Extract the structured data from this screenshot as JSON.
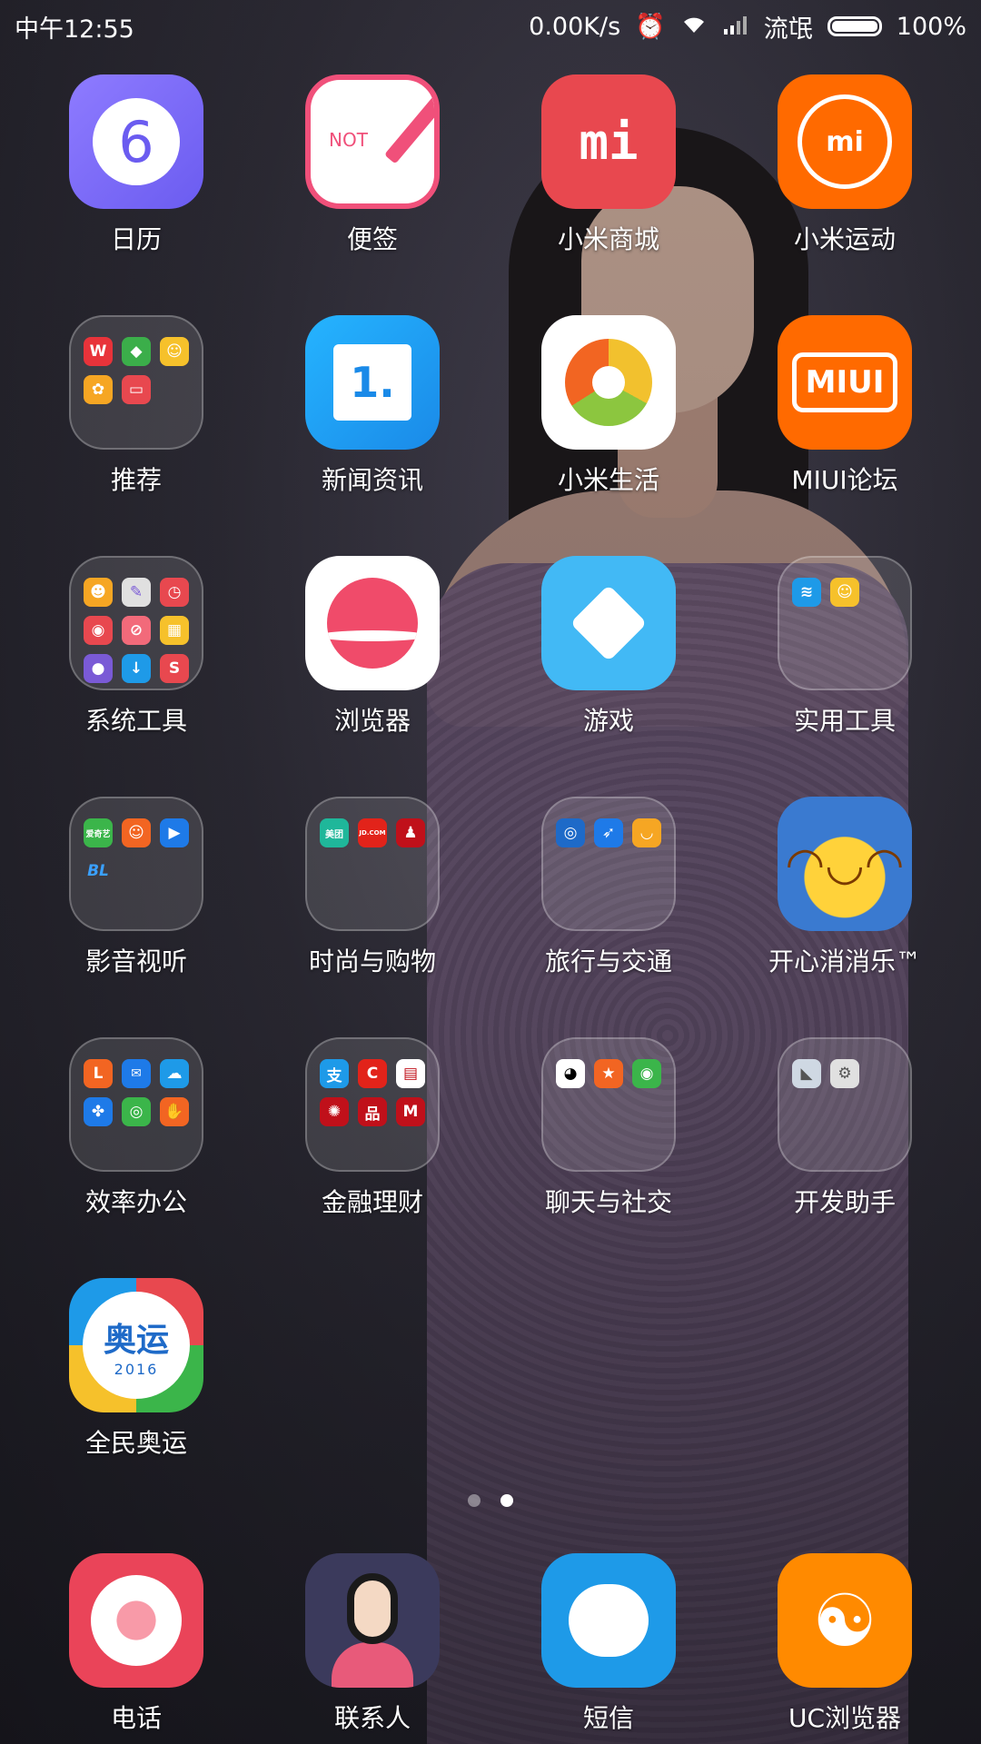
{
  "status_bar": {
    "time": "中午12:55",
    "network_speed": "0.00K/s",
    "alarm_icon": "alarm-icon",
    "wifi_icon": "wifi-icon",
    "signal_icon": "signal-icon",
    "carrier": "流氓",
    "battery_percent": "100%"
  },
  "apps": [
    {
      "label": "日历",
      "icon": "calendar-icon"
    },
    {
      "label": "便签",
      "icon": "notes-icon"
    },
    {
      "label": "小米商城",
      "icon": "mi-store-icon"
    },
    {
      "label": "小米运动",
      "icon": "mi-fit-icon"
    },
    {
      "label": "推荐",
      "icon": "folder-icon"
    },
    {
      "label": "新闻资讯",
      "icon": "news-icon"
    },
    {
      "label": "小米生活",
      "icon": "mi-life-icon"
    },
    {
      "label": "MIUI论坛",
      "icon": "miui-forum-icon"
    },
    {
      "label": "系统工具",
      "icon": "folder-icon"
    },
    {
      "label": "浏览器",
      "icon": "browser-icon"
    },
    {
      "label": "游戏",
      "icon": "game-icon"
    },
    {
      "label": "实用工具",
      "icon": "folder-icon"
    },
    {
      "label": "影音视听",
      "icon": "folder-icon"
    },
    {
      "label": "时尚与购物",
      "icon": "folder-icon"
    },
    {
      "label": "旅行与交通",
      "icon": "folder-icon"
    },
    {
      "label": "开心消消乐™",
      "icon": "happy-elimination-icon"
    },
    {
      "label": "效率办公",
      "icon": "folder-icon"
    },
    {
      "label": "金融理财",
      "icon": "folder-icon"
    },
    {
      "label": "聊天与社交",
      "icon": "folder-icon"
    },
    {
      "label": "开发助手",
      "icon": "folder-icon"
    },
    {
      "label": "全民奥运",
      "icon": "olympics-icon"
    }
  ],
  "icon_text": {
    "calendar_num": "6",
    "notes_text": "NOT",
    "mi_logo": "mi",
    "news_num": "1.",
    "miui_text": "MIUI",
    "olympics_title": "奥运",
    "olympics_year": "2016",
    "folder_iqiyi": "爱奇艺",
    "folder_bl": "BL",
    "folder_zhi": "支",
    "folder_jd": "JD.COM",
    "folder_meituan": "美团"
  },
  "pager": {
    "pages": 2,
    "current": 2
  },
  "dock": [
    {
      "label": "电话",
      "icon": "phone-icon"
    },
    {
      "label": "联系人",
      "icon": "contacts-icon"
    },
    {
      "label": "短信",
      "icon": "messages-icon"
    },
    {
      "label": "UC浏览器",
      "icon": "uc-browser-icon"
    }
  ],
  "colors": {
    "calendar": "#7b6cf0",
    "notes_border": "#f0507a",
    "mi_store": "#e8484f",
    "mi_fit": "#ff6a00",
    "news": "#1a9cf0",
    "miui": "#ff6a00",
    "browser_accent": "#f04b6a",
    "game": "#42b9f5",
    "phone": "#ea4459",
    "contacts": "#3b3a5c",
    "messages": "#1e9ae8",
    "uc": "#ff8a00"
  }
}
